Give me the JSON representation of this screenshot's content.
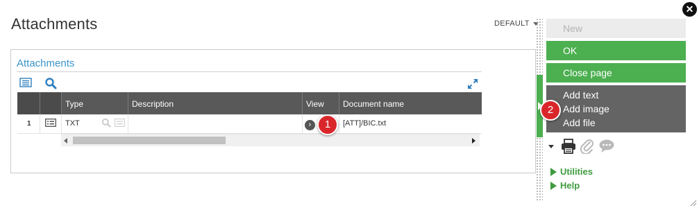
{
  "page": {
    "title": "Attachments",
    "variant": "DEFAULT"
  },
  "section": {
    "title": "Attachments"
  },
  "grid": {
    "columns": [
      "Type",
      "Description",
      "View",
      "Document name"
    ],
    "rows": [
      {
        "num": "1",
        "type": "TXT",
        "description": "",
        "view": "›",
        "document_name": "[ATT]/BIC.txt"
      }
    ]
  },
  "badges": {
    "one": "1",
    "two": "2"
  },
  "actions": {
    "new": "New",
    "ok": "OK",
    "close_page": "Close page",
    "add_text": "Add text",
    "add_image": "Add image",
    "add_file": "Add file"
  },
  "links": {
    "utilities": "Utilities",
    "help": "Help"
  },
  "window": {
    "close": "✕"
  },
  "colors": {
    "green": "#4caf50",
    "header": "#595959",
    "link_blue": "#3b95c9",
    "badge_red": "#d9262b",
    "action_gray": "#646464"
  },
  "icons": [
    "list-icon",
    "search-icon",
    "expand-icon",
    "print-icon",
    "paperclip-icon",
    "comment-icon",
    "close-icon"
  ]
}
